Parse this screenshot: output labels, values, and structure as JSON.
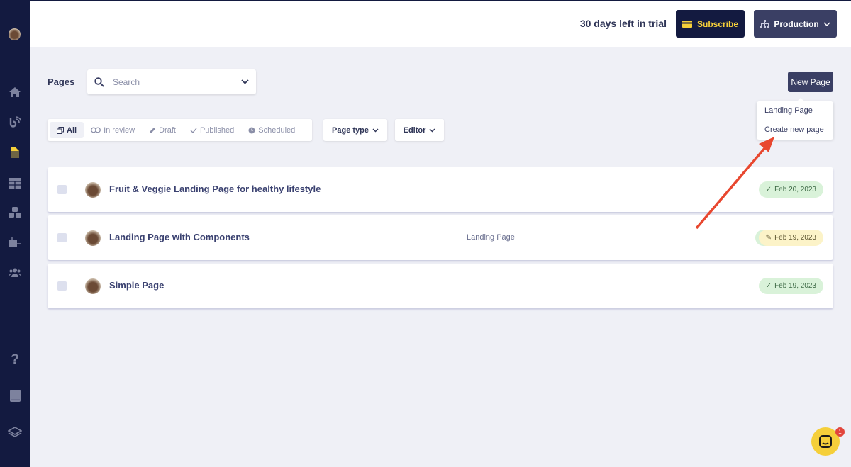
{
  "topbar": {
    "trial_text": "30 days left in trial",
    "subscribe_label": "Subscribe",
    "environment_label": "Production"
  },
  "sidebar": {
    "items": [
      "home-icon",
      "broadcast-icon",
      "pages-icon",
      "layout-icon",
      "components-icon",
      "media-icon",
      "team-icon",
      "help-icon",
      "docs-icon",
      "stack-icon"
    ]
  },
  "pages": {
    "title": "Pages",
    "search_placeholder": "Search",
    "new_page_label": "New Page",
    "new_page_menu": [
      "Landing Page",
      "Create new page"
    ],
    "filters": [
      "All",
      "In review",
      "Draft",
      "Published",
      "Scheduled"
    ],
    "dropdowns": [
      "Page type",
      "Editor"
    ],
    "rows": [
      {
        "title": "Fruit & Veggie Landing Page for healthy lifestyle",
        "type": "",
        "status": "published",
        "date": "Feb 20, 2023"
      },
      {
        "title": "Landing Page with Components",
        "type": "Landing Page",
        "status": "draft",
        "date": "Feb 19, 2023"
      },
      {
        "title": "Simple Page",
        "type": "",
        "status": "published",
        "date": "Feb 19, 2023"
      }
    ]
  },
  "chat": {
    "unread": "1"
  },
  "colors": {
    "sidebar": "#131a40",
    "accent_yellow": "#f5cf3a",
    "annotation_arrow": "#e8472f",
    "published": "#d9f2d9",
    "draft": "#fcf3c8"
  }
}
